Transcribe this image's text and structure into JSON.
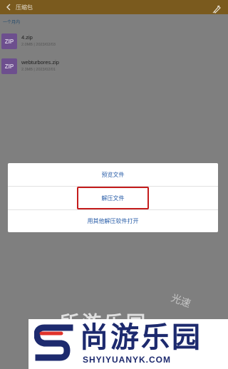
{
  "header": {
    "title": "压缩包",
    "back_icon": "chevron-left-icon",
    "action_icon": "brush-icon",
    "bg_color": "#7a5a1e"
  },
  "section": {
    "label": "一个月内"
  },
  "files": [
    {
      "icon_label": "ZIP",
      "name": "4.zip",
      "meta": "2.0MB | 2023/02/03"
    },
    {
      "icon_label": "ZIP",
      "name": "webturbores.zip",
      "meta": "2.3MB | 2023/02/01"
    }
  ],
  "dialog": {
    "options": [
      "预览文件",
      "解压文件",
      "用其他解压软件打开"
    ],
    "highlight_color": "#c41c1c"
  },
  "watermark": {
    "text": "所游乐园",
    "small_text": "光速"
  },
  "banner": {
    "title": "尚游乐园",
    "url": "SHYIYUANYK.COM",
    "brand_color": "#1d2a6e",
    "accent_color": "#e0322a"
  }
}
